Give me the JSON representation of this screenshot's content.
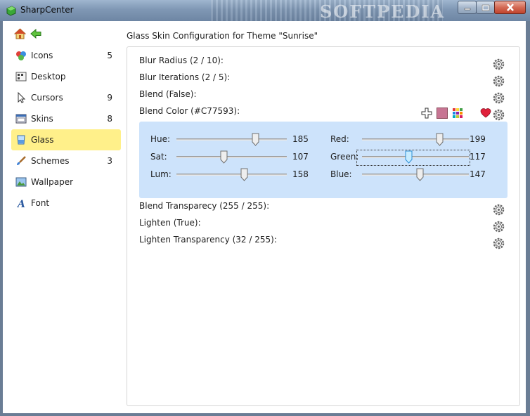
{
  "window": {
    "title": "SharpCenter",
    "watermark": "SOFTPEDIA",
    "buttons": [
      "minimize",
      "maximize",
      "close"
    ]
  },
  "nav": {
    "home_icon": "home-icon",
    "back_icon": "back-arrow-icon"
  },
  "sidebar": {
    "items": [
      {
        "label": "Icons",
        "count": "5",
        "icon": "icons-icon"
      },
      {
        "label": "Desktop",
        "count": "",
        "icon": "desktop-icon"
      },
      {
        "label": "Cursors",
        "count": "9",
        "icon": "cursor-icon"
      },
      {
        "label": "Skins",
        "count": "8",
        "icon": "skins-icon"
      },
      {
        "label": "Glass",
        "count": "",
        "icon": "glass-icon",
        "selected": true
      },
      {
        "label": "Schemes",
        "count": "3",
        "icon": "brush-icon"
      },
      {
        "label": "Wallpaper",
        "count": "",
        "icon": "wallpaper-icon"
      },
      {
        "label": "Font",
        "count": "",
        "icon": "font-icon"
      }
    ]
  },
  "main": {
    "title": "Glass Skin Configuration for Theme \"Sunrise\"",
    "properties": {
      "blur_radius": "Blur Radius (2 / 10):",
      "blur_iterations": "Blur Iterations (2 / 5):",
      "blend": "Blend (False):",
      "blend_color": "Blend Color (#C77593):",
      "blend_transparency": "Blend Transparecy (255 / 255):",
      "lighten": "Lighten (True):",
      "lighten_transparency": "Lighten Transparency (32 / 255):"
    },
    "blend_color_hex": "#C77593",
    "sliders": {
      "hue": {
        "label": "Hue:",
        "value": "185",
        "max": 239
      },
      "sat": {
        "label": "Sat:",
        "value": "107",
        "max": 240
      },
      "lum": {
        "label": "Lum:",
        "value": "158",
        "max": 240
      },
      "red": {
        "label": "Red:",
        "value": "199",
        "max": 255
      },
      "green": {
        "label": "Green:",
        "value": "117",
        "max": 255
      },
      "blue": {
        "label": "Blue:",
        "value": "147",
        "max": 255
      }
    }
  },
  "colors": {
    "selected_bg": "#fff08a",
    "panel_bg": "#cde3fb",
    "heart": "#e0203a"
  }
}
